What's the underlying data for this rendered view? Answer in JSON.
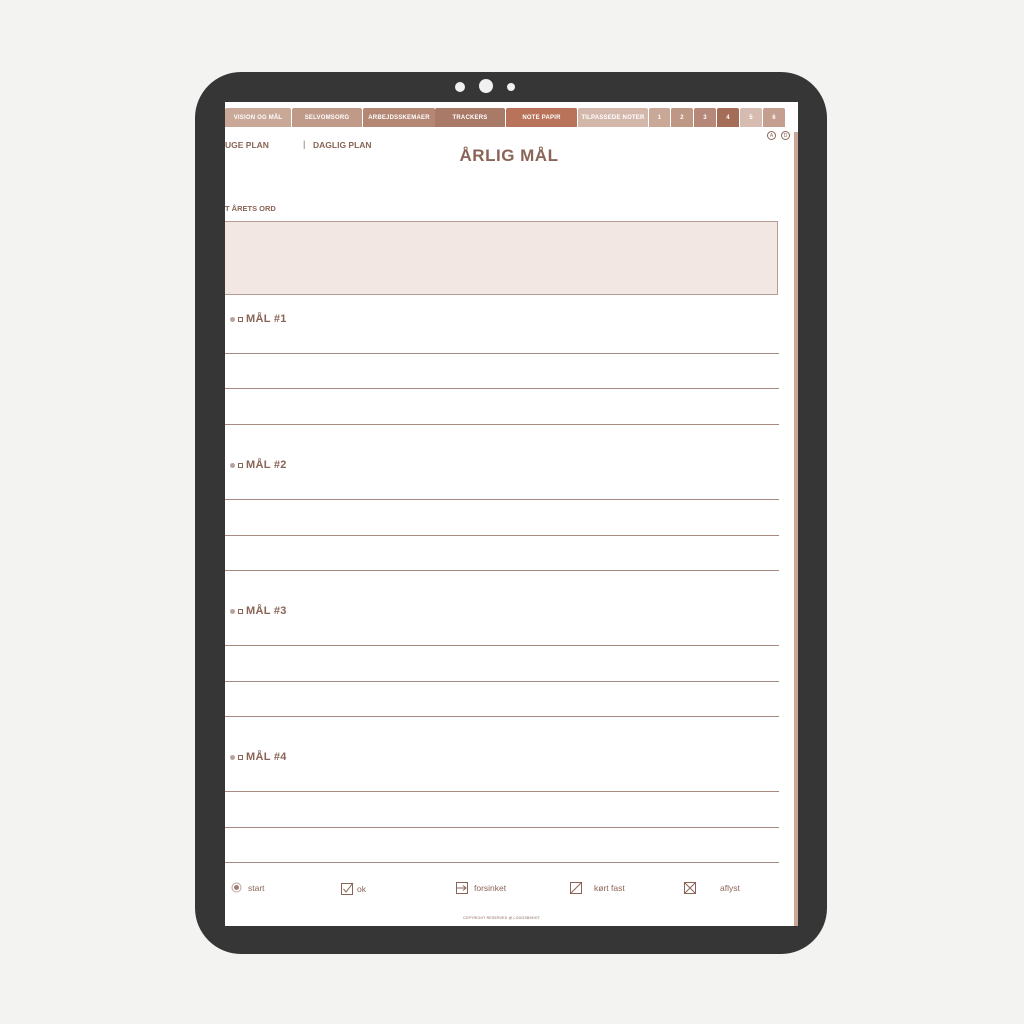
{
  "tabs": [
    {
      "label": "VISION OG MÅL",
      "color": "#c9a898"
    },
    {
      "label": "SELVOMSORG",
      "color": "#c09a89"
    },
    {
      "label": "ARBEJDSSKEMAER",
      "color": "#b48775"
    },
    {
      "label": "TRACKERS",
      "color": "#a97a68"
    },
    {
      "label": "NOTE PAPIR",
      "color": "#b8735a"
    },
    {
      "label": "TILPASSEDE NOTER",
      "color": "#d4b7ab"
    },
    {
      "label": "1",
      "color": "#c9a898"
    },
    {
      "label": "2",
      "color": "#bf9785"
    },
    {
      "label": "3",
      "color": "#b6887a"
    },
    {
      "label": "4",
      "color": "#a56c57"
    },
    {
      "label": "5",
      "color": "#d6bbb0"
    },
    {
      "label": "6",
      "color": "#c49e8e"
    }
  ],
  "nav": {
    "week": "UGE PLAN",
    "separator": "|",
    "daily": "DAGLIG PLAN"
  },
  "top_buttons": [
    "A",
    "D"
  ],
  "page_title": "ÅRLIG MÅL",
  "word_of_year_label": "T ÅRETS ORD",
  "goals": [
    "MÅL #1",
    "MÅL #2",
    "MÅL #3",
    "MÅL #4"
  ],
  "legend": [
    {
      "icon": "radio-start-icon",
      "label": "start"
    },
    {
      "icon": "checkbox-ok-icon",
      "label": "ok"
    },
    {
      "icon": "arrow-forward-icon",
      "label": "forsinket"
    },
    {
      "icon": "slash-box-icon",
      "label": "kørt fast"
    },
    {
      "icon": "x-box-icon",
      "label": "aflyst"
    }
  ],
  "copyright": "COPYRIGHT RESERVED @ LOGOSBSHOT",
  "colors": {
    "accent": "#8a6456",
    "box": "#f2e7e3",
    "bezel": "#363636",
    "background": "#f3f3f1"
  }
}
